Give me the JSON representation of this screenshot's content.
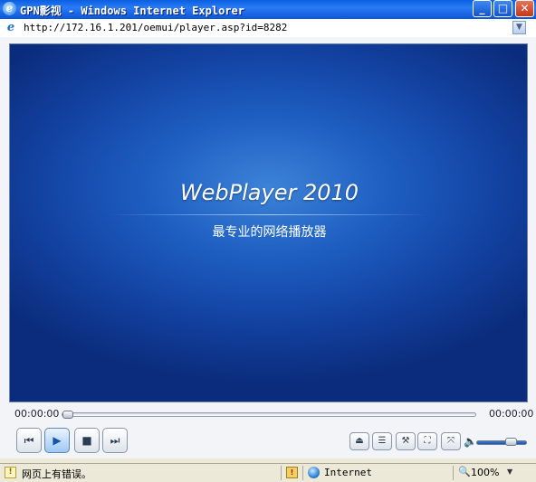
{
  "window": {
    "title": "GPN影视 - Windows Internet Explorer",
    "minimize_glyph": "_",
    "maximize_glyph": "□",
    "close_glyph": "✕"
  },
  "address_bar": {
    "url": "http://172.16.1.201/oemui/player.asp?id=8282",
    "icon": "ie-page-icon"
  },
  "player": {
    "brand": "WebPlayer 2010",
    "tagline": "最专业的网络播放器",
    "time_current": "00:00:00",
    "time_total": "00:00:00",
    "seek_progress": 0,
    "volume_level": 0.6,
    "controls": {
      "previous": "⏮",
      "play": "▶",
      "stop": "■",
      "next": "⏭"
    },
    "small_controls": {
      "eject": "⏏",
      "playlist": "☰",
      "tools": "⚒",
      "fullscreen": "⛶",
      "fit": "⤧"
    },
    "colors": {
      "video_bg": "#1e5fc2",
      "play_button": "#9cc8f3"
    }
  },
  "status_bar": {
    "message": "网页上有错误。",
    "zone": "Internet",
    "zoom": "100%"
  }
}
